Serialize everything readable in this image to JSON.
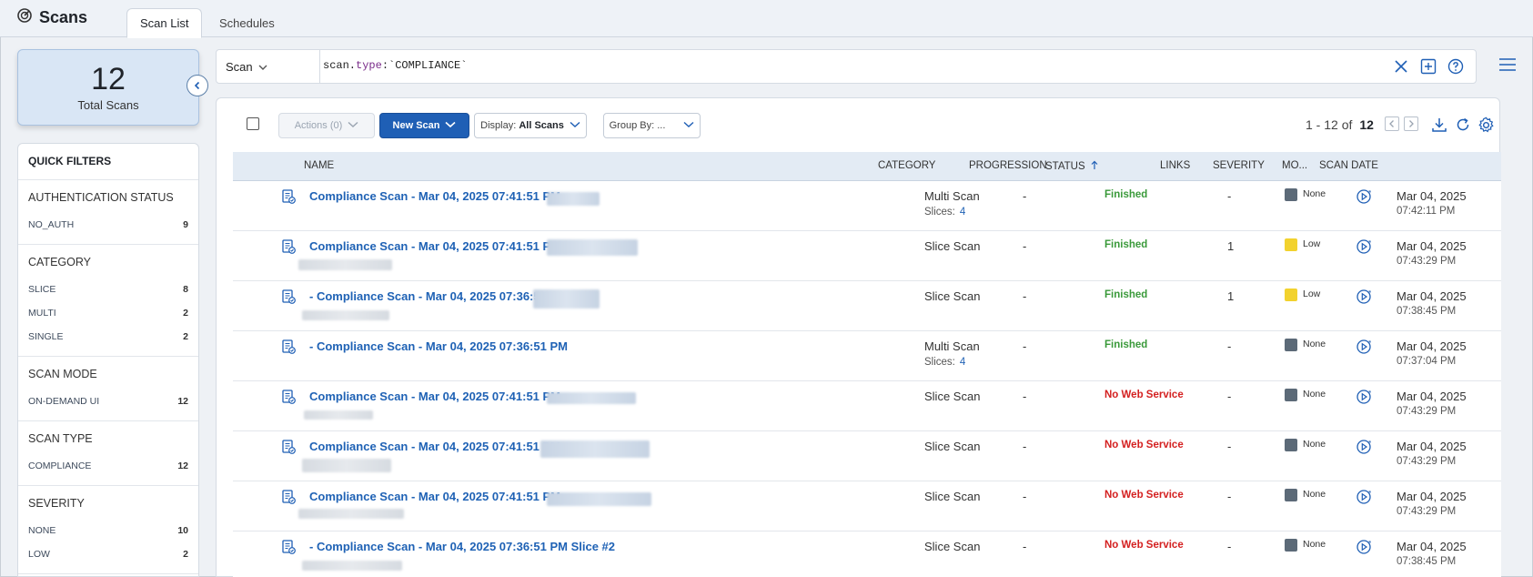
{
  "app": {
    "title": "Scans",
    "icon": "radar-icon"
  },
  "tabs": [
    {
      "label": "Scan List",
      "active": true
    },
    {
      "label": "Schedules",
      "active": false
    }
  ],
  "summary": {
    "total": "12",
    "label": "Total Scans"
  },
  "search": {
    "scope": "Scan",
    "query_key": "scan.",
    "query_field": "type",
    "query_value": ":`COMPLIANCE`"
  },
  "quick_filters": {
    "title": "QUICK FILTERS",
    "groups": [
      {
        "title": "AUTHENTICATION STATUS",
        "items": [
          {
            "label": "NO_AUTH",
            "count": "9"
          }
        ]
      },
      {
        "title": "CATEGORY",
        "items": [
          {
            "label": "SLICE",
            "count": "8"
          },
          {
            "label": "MULTI",
            "count": "2"
          },
          {
            "label": "SINGLE",
            "count": "2"
          }
        ]
      },
      {
        "title": "SCAN MODE",
        "items": [
          {
            "label": "ON-DEMAND UI",
            "count": "12"
          }
        ]
      },
      {
        "title": "SCAN TYPE",
        "items": [
          {
            "label": "COMPLIANCE",
            "count": "12"
          }
        ]
      },
      {
        "title": "SEVERITY",
        "items": [
          {
            "label": "NONE",
            "count": "10"
          },
          {
            "label": "LOW",
            "count": "2"
          }
        ]
      }
    ]
  },
  "toolbar": {
    "actions": "Actions (0)",
    "new_scan": "New Scan",
    "display_prefix": "Display:",
    "display_value": "All Scans",
    "group_by": "Group By: ...",
    "pager_range": "1 - 12 of",
    "pager_total": "12"
  },
  "columns": {
    "name": "NAME",
    "category": "CATEGORY",
    "progression": "PROGRESSION",
    "status": "STATUS",
    "links": "LINKS",
    "severity": "SEVERITY",
    "mode": "MO...",
    "scan_date": "SCAN DATE"
  },
  "colors": {
    "accent": "#1f5fb5",
    "finished": "#3a9a3a",
    "no_web_service": "#d42020",
    "severity_none": "#5c6a78",
    "severity_low": "#f2d22e"
  },
  "rows": [
    {
      "name": "Compliance Scan - Mar 04, 2025 07:41:51 PM -",
      "category": "Multi Scan",
      "slices_label": "Slices:",
      "slices": "4",
      "progression": "-",
      "status": "Finished",
      "status_kind": "ok",
      "links": "-",
      "severity": "None",
      "severity_kind": "none",
      "date": "Mar 04, 2025",
      "time": "07:42:11 PM"
    },
    {
      "name": "Compliance Scan - Mar 04, 2025 07:41:51 PM -",
      "category": "Slice Scan",
      "progression": "-",
      "status": "Finished",
      "status_kind": "ok",
      "links": "1",
      "severity": "Low",
      "severity_kind": "low",
      "date": "Mar 04, 2025",
      "time": "07:43:29 PM"
    },
    {
      "name": "- Compliance Scan - Mar 04, 2025 07:36:51 I",
      "category": "Slice Scan",
      "progression": "-",
      "status": "Finished",
      "status_kind": "ok",
      "links": "1",
      "severity": "Low",
      "severity_kind": "low",
      "date": "Mar 04, 2025",
      "time": "07:38:45 PM"
    },
    {
      "name": "- Compliance Scan - Mar 04, 2025 07:36:51 PM",
      "category": "Multi Scan",
      "slices_label": "Slices:",
      "slices": "4",
      "progression": "-",
      "status": "Finished",
      "status_kind": "ok",
      "links": "-",
      "severity": "None",
      "severity_kind": "none",
      "date": "Mar 04, 2025",
      "time": "07:37:04 PM"
    },
    {
      "name": "Compliance Scan - Mar 04, 2025 07:41:51 PM -",
      "category": "Slice Scan",
      "progression": "-",
      "status": "No Web Service",
      "status_kind": "bad",
      "links": "-",
      "severity": "None",
      "severity_kind": "none",
      "date": "Mar 04, 2025",
      "time": "07:43:29 PM"
    },
    {
      "name": "Compliance Scan - Mar 04, 2025 07:41:51 PM",
      "category": "Slice Scan",
      "progression": "-",
      "status": "No Web Service",
      "status_kind": "bad",
      "links": "-",
      "severity": "None",
      "severity_kind": "none",
      "date": "Mar 04, 2025",
      "time": "07:43:29 PM"
    },
    {
      "name": "Compliance Scan - Mar 04, 2025 07:41:51 PM -",
      "category": "Slice Scan",
      "progression": "-",
      "status": "No Web Service",
      "status_kind": "bad",
      "links": "-",
      "severity": "None",
      "severity_kind": "none",
      "date": "Mar 04, 2025",
      "time": "07:43:29 PM"
    },
    {
      "name": "- Compliance Scan - Mar 04, 2025 07:36:51 PM Slice #2",
      "category": "Slice Scan",
      "progression": "-",
      "status": "No Web Service",
      "status_kind": "bad",
      "links": "-",
      "severity": "None",
      "severity_kind": "none",
      "date": "Mar 04, 2025",
      "time": "07:38:45 PM"
    }
  ]
}
